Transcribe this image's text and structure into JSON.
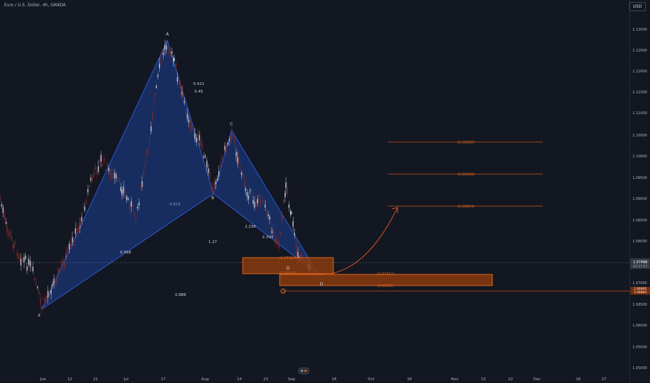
{
  "header": {
    "title": "Euro / U.S. Dollar, 4h, OANDA",
    "currency": "USD"
  },
  "price_axis": {
    "ticks": [
      "1.13000",
      "1.12500",
      "1.12000",
      "1.11500",
      "1.11000",
      "1.10500",
      "1.10000",
      "1.09500",
      "1.09000",
      "1.08500",
      "1.08000",
      "1.07500",
      "1.07000",
      "1.06500",
      "1.06000",
      "1.05500",
      "1.05000"
    ],
    "current_price": "1.07488",
    "countdown": "01:17:57",
    "bottom_label_1": "1.06905",
    "bottom_label_2": "1.06863"
  },
  "time_axis": {
    "ticks": [
      "Jun",
      "12",
      "21",
      "Jul",
      "17",
      "Aug",
      "14",
      "23",
      "Sep",
      "18",
      "Oct",
      "16",
      "Nov",
      "13",
      "22",
      "Dec",
      "18",
      "27"
    ]
  },
  "pattern": {
    "points": {
      "X": "X",
      "A": "A",
      "B": "B",
      "C": "C",
      "D": "D",
      "D2": "D"
    },
    "ratios": {
      "r1": "0.421",
      "r2": "0.45",
      "r3": "0.816",
      "r4": "0.568",
      "r5": "1.27",
      "r6": "2.236",
      "r7": "2.334",
      "r8": "0.886"
    }
  },
  "levels": {
    "t1": "(1.10322)",
    "t2": "(1.09568)",
    "t3": "(1.08814)",
    "z1": "(1.07316)",
    "z2": "(1.07237)",
    "z3": "(1.07317)",
    "z4": "(1.06831)"
  },
  "colors": {
    "background": "#131722",
    "pattern_fill": "#1e3c8c",
    "zone": "#e0661a",
    "level_line": "#d2561a"
  }
}
